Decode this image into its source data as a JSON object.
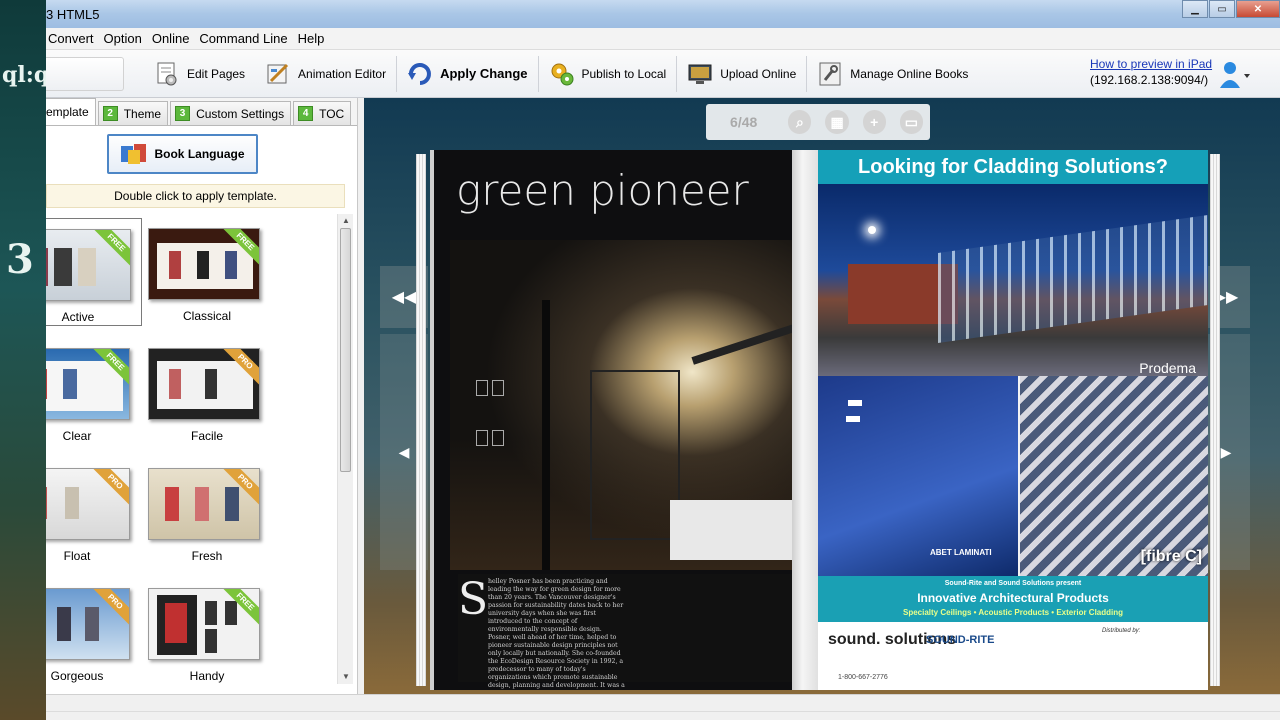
{
  "window": {
    "title": "3 HTML5"
  },
  "menu": [
    "Convert",
    "Option",
    "Online",
    "Command Line",
    "Help"
  ],
  "toolbar": {
    "edit_pages": "Edit Pages",
    "animation_editor": "Animation Editor",
    "apply_change": "Apply Change",
    "publish_local": "Publish to Local",
    "upload_online": "Upload Online",
    "manage_online": "Manage Online Books",
    "preview_link": "How to preview in iPad",
    "preview_ip": "(192.168.2.138:9094/)"
  },
  "tabs": [
    {
      "num": "",
      "label": "emplate"
    },
    {
      "num": "2",
      "label": "Theme"
    },
    {
      "num": "3",
      "label": "Custom Settings"
    },
    {
      "num": "4",
      "label": "TOC"
    }
  ],
  "panel": {
    "book_language": "Book Language",
    "hint": "Double click to apply template."
  },
  "templates": [
    {
      "name": "Active",
      "badge": "FREE"
    },
    {
      "name": "Classical",
      "badge": "FREE"
    },
    {
      "name": "Clear",
      "badge": "FREE"
    },
    {
      "name": "Facile",
      "badge": "PRO"
    },
    {
      "name": "Float",
      "badge": "PRO"
    },
    {
      "name": "Fresh",
      "badge": "PRO"
    },
    {
      "name": "Gorgeous",
      "badge": "PRO"
    },
    {
      "name": "Handy",
      "badge": "FREE"
    }
  ],
  "preview": {
    "page_indicator": "6/48",
    "left_page": {
      "title": "green pioneer",
      "dropcap": "S",
      "body": "helley Posner has been practicing and leading the way for green design for more than 20 years. The Vancouver designer's passion for sustainability dates back to her university days when she was first introduced to the concept of environmentally responsible design. Posner, well ahead of her time, helped to pioneer sustainable design principles not only locally but nationally. She co-founded the EcoDesign Resource Society in 1992, a predecessor to many of today's organizations which promote sustainable design, planning and development. It was a grassroots non-profit multidisciplinary organization created to encourage and provide environmental resources for design and construction."
    },
    "right_page": {
      "headline": "Looking for Cladding Solutions?",
      "prodema": "Prodema",
      "abet": "ABET LAMINATI",
      "fibre": "[fibre C]",
      "band_line1": "Sound-Rite and Sound Solutions present",
      "band_line2": "Innovative Architectural Products",
      "band_line3": "Specialty Ceilings  •  Acoustic Products  •  Exterior Cladding",
      "sound_solutions": "sound. solutions",
      "phone": "1-800-667-2776",
      "sound_rite": "SOUND-RITE",
      "distributed": "Distributed by:"
    }
  },
  "colors": {
    "accent_teal": "#15a0b8",
    "tab_green": "#5cb83c",
    "link_blue": "#1a38b8"
  }
}
